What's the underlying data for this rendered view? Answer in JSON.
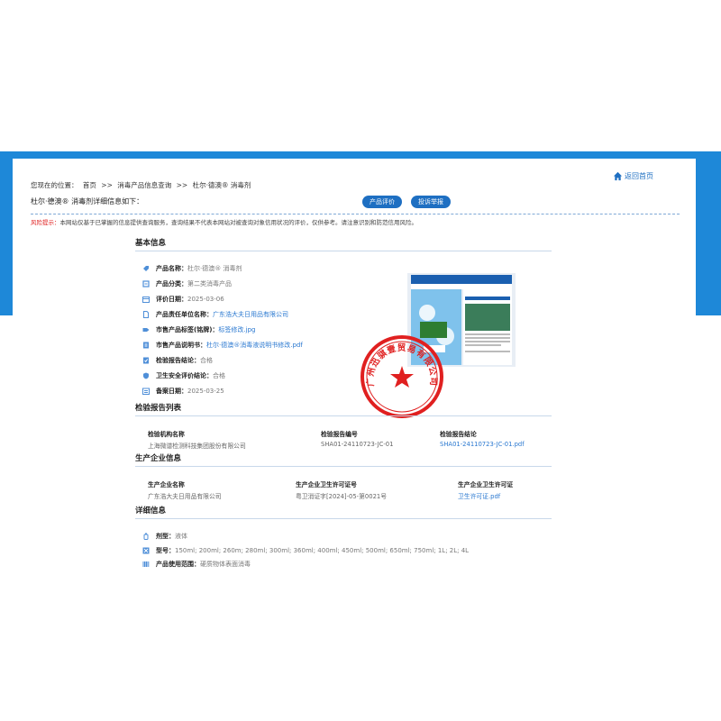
{
  "breadcrumb": {
    "prefix": "您现在的位置：",
    "items": [
      "首页",
      ">>",
      "消毒产品信息查询",
      ">>",
      "杜尔·德澳® 消毒剂"
    ]
  },
  "home_link": "返回首页",
  "subtitle": "杜尔·德澳® 消毒剂详细信息如下：",
  "buttons": {
    "evaluate": "产品评价",
    "complaint": "投诉举报"
  },
  "risk": {
    "label": "风险提示：",
    "text": "本网站仅基于已掌握的信息提供查询服务，查询结果不代表本网站对被查询对象信用状况的评价，仅供参考。请注意识别和防范信用风险。"
  },
  "basic": {
    "title": "基本信息",
    "rows": [
      {
        "k": "产品名称：",
        "v": "杜尔·德澳® 消毒剂",
        "link": false
      },
      {
        "k": "产品分类：",
        "v": "第二类消毒产品",
        "link": false
      },
      {
        "k": "评价日期：",
        "v": "2025-03-06",
        "link": false
      },
      {
        "k": "产品责任单位名称：",
        "v": "广东浩大夫日用品有限公司",
        "link": true
      },
      {
        "k": "市售产品标签(铭牌)：",
        "v": "标签修改.jpg",
        "link": true
      },
      {
        "k": "市售产品说明书：",
        "v": "杜尔·德澳®消毒液说明书修改.pdf",
        "link": true
      },
      {
        "k": "检验报告结论：",
        "v": "合格",
        "link": false
      },
      {
        "k": "卫生安全评价结论：",
        "v": "合格",
        "link": false
      },
      {
        "k": "备案日期：",
        "v": "2025-03-25",
        "link": false
      }
    ]
  },
  "report": {
    "title": "检验报告列表",
    "headers": [
      "检验机构名称",
      "检验报告编号",
      "检验报告结论"
    ],
    "values": [
      "上海微谱检测科技集团股份有限公司",
      "SHA01-24110723-JC-01",
      "SHA01-24110723-JC-01.pdf"
    ]
  },
  "producer": {
    "title": "生产企业信息",
    "headers": [
      "生产企业名称",
      "生产企业卫生许可证号",
      "生产企业卫生许可证"
    ],
    "values": [
      "广东浩大夫日用品有限公司",
      "粤卫消证字[2024]-05-第0021号",
      "卫生许可证.pdf"
    ]
  },
  "detail": {
    "title": "详细信息",
    "rows": [
      {
        "k": "剂型：",
        "v": "液体"
      },
      {
        "k": "型号：",
        "v": "150ml; 200ml; 260m; 280ml; 300ml; 360ml; 400ml; 450ml; 500ml; 650ml; 750ml; 1L; 2L; 4L"
      },
      {
        "k": "产品使用范围：",
        "v": "硬质物体表面消毒"
      }
    ]
  },
  "stamp_text": "广州迅骐壹贸易有限公司",
  "colors": {
    "brand": "#1e88d8",
    "link": "#2a78d0",
    "button": "#1e6fc2",
    "stamp": "#e02020"
  }
}
